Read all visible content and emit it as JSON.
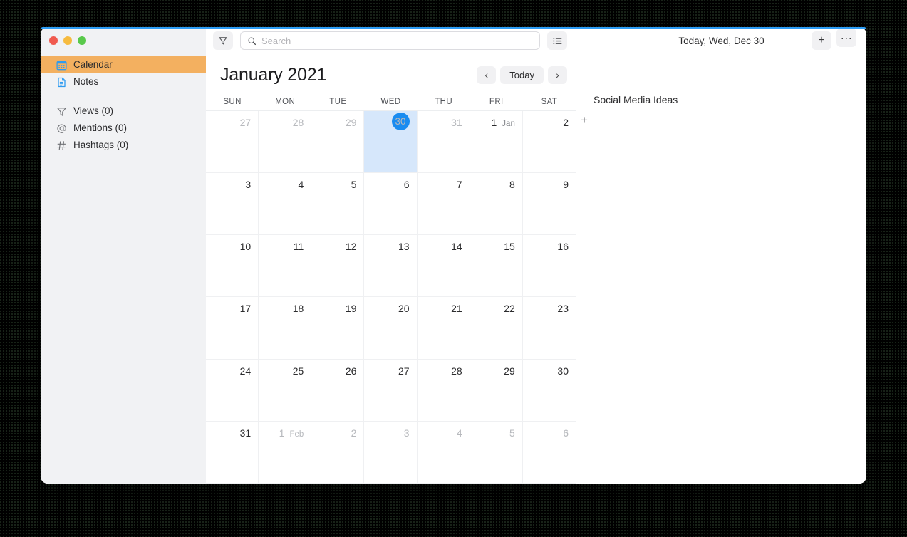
{
  "window": {
    "traffic_lights": [
      "close",
      "minimize",
      "zoom"
    ],
    "accent_color": "#2d9cf5"
  },
  "sidebar": {
    "background": "#f1f2f4",
    "selected_color": "#f3b060",
    "groups": [
      {
        "items": [
          {
            "label": "Calendar",
            "icon": "calendar-icon",
            "selected": true
          },
          {
            "label": "Notes",
            "icon": "note-document-icon",
            "selected": false
          }
        ]
      },
      {
        "items": [
          {
            "label": "Views (0)",
            "icon": "filter-funnel-icon",
            "selected": false
          },
          {
            "label": "Mentions (0)",
            "icon": "at-sign-icon",
            "selected": false
          },
          {
            "label": "Hashtags (0)",
            "icon": "hashtag-icon",
            "selected": false
          }
        ]
      }
    ]
  },
  "calendar": {
    "toolbar": {
      "filter_icon": "filter-funnel-icon",
      "list_icon": "list-view-icon"
    },
    "search": {
      "value": "",
      "placeholder": "Search",
      "icon": "search-icon"
    },
    "month_title": "January 2021",
    "nav": {
      "prev_label": "‹",
      "today_label": "Today",
      "next_label": "›"
    },
    "weekdays": [
      "SUN",
      "MON",
      "TUE",
      "WED",
      "THU",
      "FRI",
      "SAT"
    ],
    "today_column_index": 3,
    "today_highlight_color": "#d6e7fb",
    "today_circle_color": "#1a8cf0",
    "weeks": [
      [
        {
          "day": "27",
          "month_tag": "",
          "other_month": true,
          "is_today": false
        },
        {
          "day": "28",
          "month_tag": "",
          "other_month": true,
          "is_today": false
        },
        {
          "day": "29",
          "month_tag": "",
          "other_month": true,
          "is_today": false
        },
        {
          "day": "30",
          "month_tag": "",
          "other_month": true,
          "is_today": true
        },
        {
          "day": "31",
          "month_tag": "",
          "other_month": true,
          "is_today": false
        },
        {
          "day": "1",
          "month_tag": "Jan",
          "other_month": false,
          "is_today": false
        },
        {
          "day": "2",
          "month_tag": "",
          "other_month": false,
          "is_today": false
        }
      ],
      [
        {
          "day": "3",
          "month_tag": "",
          "other_month": false,
          "is_today": false
        },
        {
          "day": "4",
          "month_tag": "",
          "other_month": false,
          "is_today": false
        },
        {
          "day": "5",
          "month_tag": "",
          "other_month": false,
          "is_today": false
        },
        {
          "day": "6",
          "month_tag": "",
          "other_month": false,
          "is_today": false
        },
        {
          "day": "7",
          "month_tag": "",
          "other_month": false,
          "is_today": false
        },
        {
          "day": "8",
          "month_tag": "",
          "other_month": false,
          "is_today": false
        },
        {
          "day": "9",
          "month_tag": "",
          "other_month": false,
          "is_today": false
        }
      ],
      [
        {
          "day": "10",
          "month_tag": "",
          "other_month": false,
          "is_today": false
        },
        {
          "day": "11",
          "month_tag": "",
          "other_month": false,
          "is_today": false
        },
        {
          "day": "12",
          "month_tag": "",
          "other_month": false,
          "is_today": false
        },
        {
          "day": "13",
          "month_tag": "",
          "other_month": false,
          "is_today": false
        },
        {
          "day": "14",
          "month_tag": "",
          "other_month": false,
          "is_today": false
        },
        {
          "day": "15",
          "month_tag": "",
          "other_month": false,
          "is_today": false
        },
        {
          "day": "16",
          "month_tag": "",
          "other_month": false,
          "is_today": false
        }
      ],
      [
        {
          "day": "17",
          "month_tag": "",
          "other_month": false,
          "is_today": false
        },
        {
          "day": "18",
          "month_tag": "",
          "other_month": false,
          "is_today": false
        },
        {
          "day": "19",
          "month_tag": "",
          "other_month": false,
          "is_today": false
        },
        {
          "day": "20",
          "month_tag": "",
          "other_month": false,
          "is_today": false
        },
        {
          "day": "21",
          "month_tag": "",
          "other_month": false,
          "is_today": false
        },
        {
          "day": "22",
          "month_tag": "",
          "other_month": false,
          "is_today": false
        },
        {
          "day": "23",
          "month_tag": "",
          "other_month": false,
          "is_today": false
        }
      ],
      [
        {
          "day": "24",
          "month_tag": "",
          "other_month": false,
          "is_today": false
        },
        {
          "day": "25",
          "month_tag": "",
          "other_month": false,
          "is_today": false
        },
        {
          "day": "26",
          "month_tag": "",
          "other_month": false,
          "is_today": false
        },
        {
          "day": "27",
          "month_tag": "",
          "other_month": false,
          "is_today": false
        },
        {
          "day": "28",
          "month_tag": "",
          "other_month": false,
          "is_today": false
        },
        {
          "day": "29",
          "month_tag": "",
          "other_month": false,
          "is_today": false
        },
        {
          "day": "30",
          "month_tag": "",
          "other_month": false,
          "is_today": false
        }
      ],
      [
        {
          "day": "31",
          "month_tag": "",
          "other_month": false,
          "is_today": false
        },
        {
          "day": "1",
          "month_tag": "Feb",
          "other_month": true,
          "is_today": false
        },
        {
          "day": "2",
          "month_tag": "",
          "other_month": true,
          "is_today": false
        },
        {
          "day": "3",
          "month_tag": "",
          "other_month": true,
          "is_today": false
        },
        {
          "day": "4",
          "month_tag": "",
          "other_month": true,
          "is_today": false
        },
        {
          "day": "5",
          "month_tag": "",
          "other_month": true,
          "is_today": false
        },
        {
          "day": "6",
          "month_tag": "",
          "other_month": true,
          "is_today": false
        }
      ]
    ]
  },
  "detail_panel": {
    "date_label": "Today, Wed, Dec 30",
    "add_button_label": "+",
    "more_button_label": "···",
    "note_title": "Social Media Ideas",
    "add_item_label": "+"
  }
}
